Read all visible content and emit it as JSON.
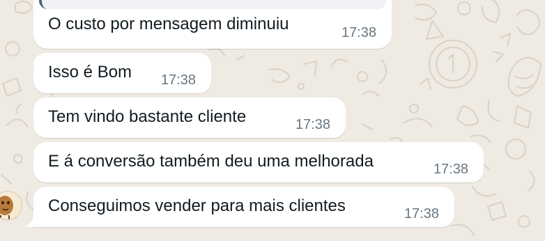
{
  "chat": {
    "messages": [
      {
        "text": "O custo por mensagem diminuiu",
        "time": "17:38"
      },
      {
        "text": "Isso é Bom",
        "time": "17:38"
      },
      {
        "text": "Tem vindo bastante cliente",
        "time": "17:38"
      },
      {
        "text": "E á conversão também deu uma melhorada",
        "time": "17:38"
      },
      {
        "text": "Conseguimos vender para mais clientes",
        "time": "17:38"
      }
    ]
  },
  "theme": {
    "background": "#efeae2",
    "bubble": "#ffffff",
    "text": "#111b21",
    "timestamp": "#667781"
  },
  "icons": {
    "avatar": "sender-avatar-icon",
    "wallpaper": "doodle-wallpaper"
  }
}
